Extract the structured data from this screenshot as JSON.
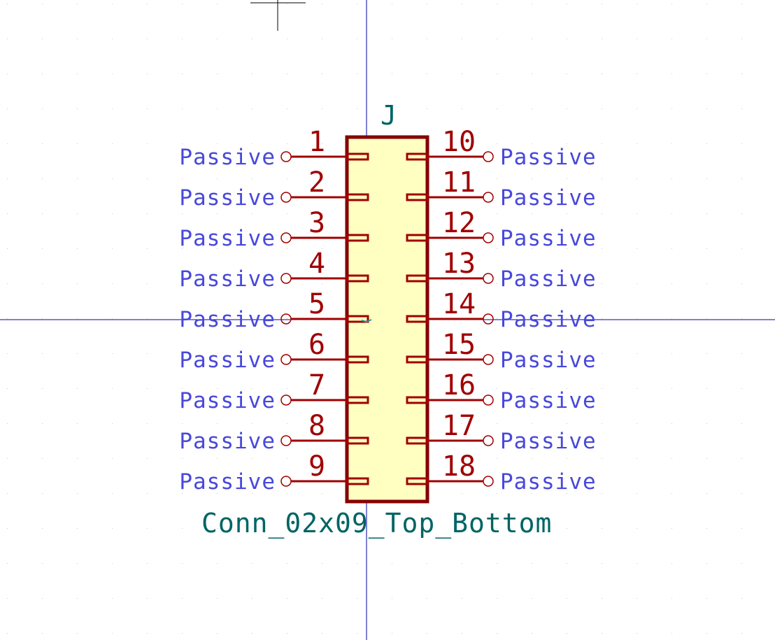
{
  "colors": {
    "background": "#ffffff",
    "axis": "#0000aa",
    "grid_dot": "#c8c8c8",
    "body_outline": "#840000",
    "body_fill": "#ffffc2",
    "pin_line": "#a00000",
    "pin_number": "#a00000",
    "pin_type": "#4848dc",
    "reference": "#006464",
    "value": "#006464"
  },
  "symbol": {
    "reference": "J",
    "value": "Conn_02x09_Top_Bottom",
    "left_pins": [
      {
        "number": "1",
        "type": "Passive"
      },
      {
        "number": "2",
        "type": "Passive"
      },
      {
        "number": "3",
        "type": "Passive"
      },
      {
        "number": "4",
        "type": "Passive"
      },
      {
        "number": "5",
        "type": "Passive"
      },
      {
        "number": "6",
        "type": "Passive"
      },
      {
        "number": "7",
        "type": "Passive"
      },
      {
        "number": "8",
        "type": "Passive"
      },
      {
        "number": "9",
        "type": "Passive"
      }
    ],
    "right_pins": [
      {
        "number": "10",
        "type": "Passive"
      },
      {
        "number": "11",
        "type": "Passive"
      },
      {
        "number": "12",
        "type": "Passive"
      },
      {
        "number": "13",
        "type": "Passive"
      },
      {
        "number": "14",
        "type": "Passive"
      },
      {
        "number": "15",
        "type": "Passive"
      },
      {
        "number": "16",
        "type": "Passive"
      },
      {
        "number": "17",
        "type": "Passive"
      },
      {
        "number": "18",
        "type": "Passive"
      }
    ]
  }
}
